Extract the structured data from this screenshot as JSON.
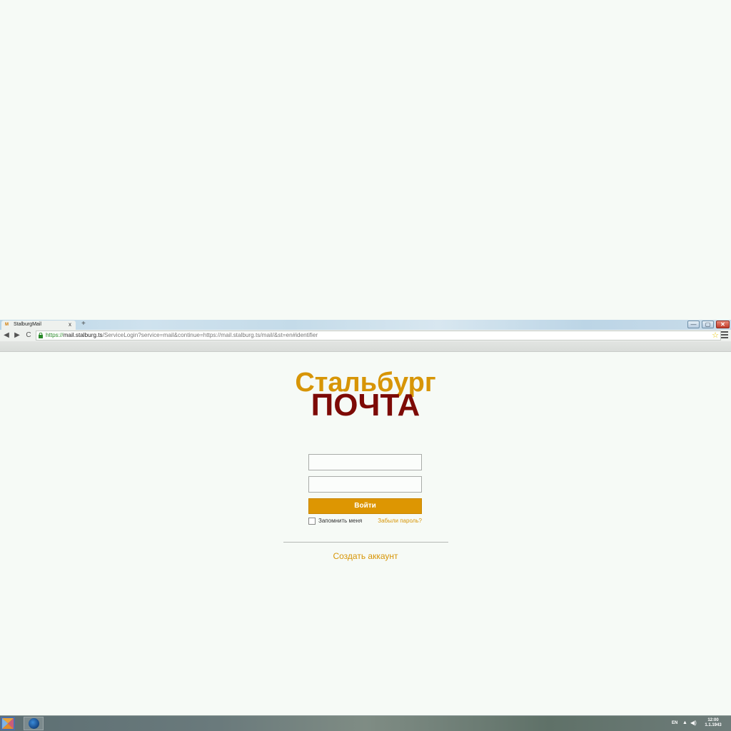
{
  "browser": {
    "tab": {
      "title": "StalburgMail",
      "close_glyph": "x",
      "favicon": "mail-icon",
      "favicon_text": "M"
    },
    "new_tab_glyph": "+",
    "window_controls": {
      "minimize_glyph": "—",
      "maximize_glyph": "▢",
      "close_glyph": "✕"
    },
    "nav": {
      "back_glyph": "◀",
      "forward_glyph": "▶",
      "reload_glyph": "C"
    },
    "address": {
      "scheme": "https://",
      "host": "mail.stalburg.ts",
      "rest": "/ServiceLogin?service=mail&continue=https://mail.stalburg.ts/mail/&st=en#identifier"
    },
    "star_glyph": "☆"
  },
  "page": {
    "logo": {
      "line1": "Стальбург",
      "line2": "ПОЧТА",
      "line1_color": "#d79506",
      "line2_color": "#7d0a06"
    },
    "form": {
      "username_value": "",
      "password_value": "",
      "submit_label": "Войти",
      "remember_label": "Запомнить меня",
      "forgot_link": "Забыли пароль?"
    },
    "create_account_link": "Создать аккаунт",
    "accent_color": "#dd9602"
  },
  "taskbar": {
    "language": "EN",
    "tray_arrow_glyph": "▲",
    "volume_glyph": "◀)",
    "time": "12:00",
    "date": "1.1.1943"
  }
}
